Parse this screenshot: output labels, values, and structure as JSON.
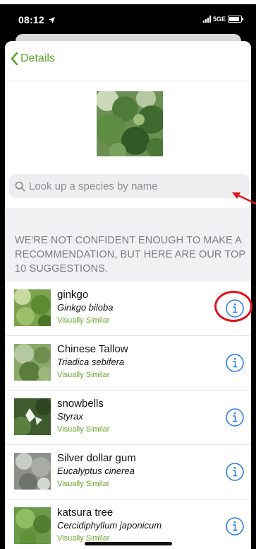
{
  "status_bar": {
    "time": "08:12",
    "network": "5GE"
  },
  "nav": {
    "back_label": "Details"
  },
  "search": {
    "placeholder": "Look up a species by name"
  },
  "notice": {
    "text": "WE'RE NOT CONFIDENT ENOUGH TO MAKE A RECOMMENDATION, BUT HERE ARE OUR TOP 10 SUGGESTIONS."
  },
  "suggestions": [
    {
      "common": "ginkgo",
      "scientific": "Ginkgo biloba",
      "tag": "Visually Similar"
    },
    {
      "common": "Chinese Tallow",
      "scientific": "Triadica sebifera",
      "tag": "Visually Similar"
    },
    {
      "common": "snowbells",
      "scientific": "Styrax",
      "tag": "Visually Similar"
    },
    {
      "common": "Silver dollar gum",
      "scientific": "Eucalyptus cinerea",
      "tag": "Visually Similar"
    },
    {
      "common": "katsura tree",
      "scientific": "Cercidiphyllum japonicum",
      "tag": "Visually Similar"
    }
  ],
  "colors": {
    "accent_green": "#5aa42c",
    "info_blue": "#2f7fe8",
    "highlight_red": "#e0141e"
  },
  "icons": [
    "location-arrow-icon",
    "signal-icon",
    "battery-icon",
    "chevron-left-icon",
    "search-icon",
    "info-icon",
    "red-arrow-annotation"
  ]
}
